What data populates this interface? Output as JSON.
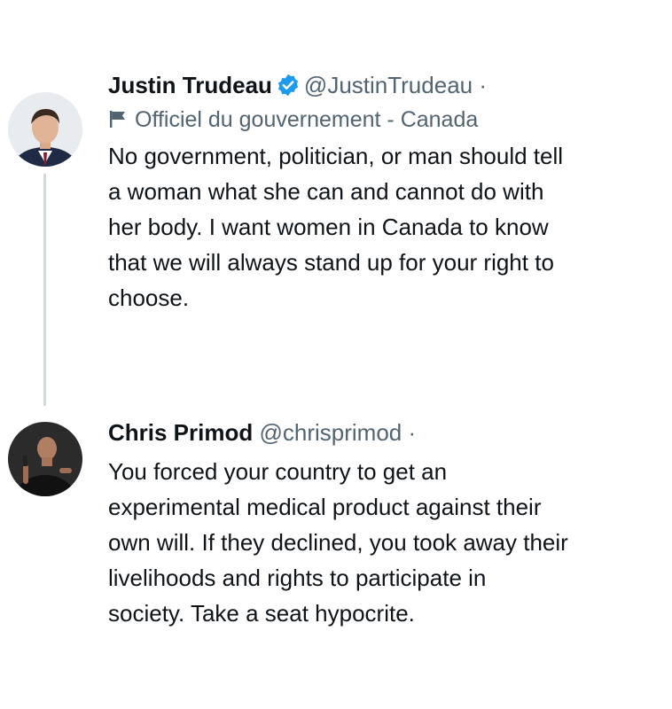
{
  "tweets": [
    {
      "display_name": "Justin Trudeau",
      "handle": "@JustinTrudeau",
      "separator": "·",
      "verified_icon": "verified-badge-icon",
      "label": "Officiel du gouvernement - Canada",
      "label_icon": "flag-icon",
      "text_lines": [
        "No government, politician, or man should tell",
        "a woman what she can and cannot do with",
        "her body. I want women in Canada to know",
        "that we will always stand up for your right to",
        "choose."
      ]
    },
    {
      "display_name": "Chris Primod",
      "handle": "@chrisprimod",
      "separator": "·",
      "text_lines": [
        "You forced your country to get an",
        "experimental medical product against their",
        "own will. If they declined, you took away their",
        "livelihoods and rights to participate in",
        "society. Take a seat hypocrite."
      ]
    }
  ],
  "colors": {
    "text": "#0f1419",
    "secondary": "#536471",
    "verified": "#1d9bf0",
    "thread_line": "#cfd9de"
  }
}
